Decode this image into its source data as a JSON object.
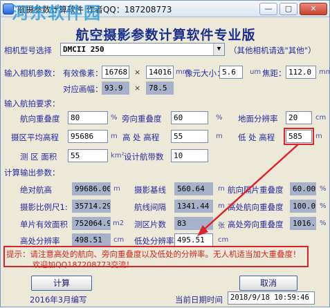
{
  "window": {
    "title": "航摄参数计算软件  作者QQ：187208773",
    "watermark": "河东软件园",
    "watermark_url": "www.pc0359.cn",
    "minimize": "—",
    "maximize": "▢",
    "close": "✕"
  },
  "heading": "航空摄影参数计算软件专业版",
  "camera": {
    "label": "相机型号选择",
    "value": "DMCII 250",
    "hint": "（其他相机请选\"其他\"）"
  },
  "camera_params": {
    "label": "输入相机参数：",
    "pixels_label": "有效像素：",
    "pixels_w": "16768",
    "pixels_h": "14016",
    "pixels_unit": "mm",
    "times": "×",
    "pixel_size_label": "像元大小：",
    "pixel_size": "5.6",
    "pixel_size_unit": "um",
    "focal_label": "焦距：",
    "focal": "112.0",
    "focal_unit": "mm",
    "frame_label": "对应画幅：",
    "frame_w": "93.9",
    "frame_h": "78.5"
  },
  "flight_req": {
    "label": "输入航拍要求：",
    "forward_overlap_label": "航向重叠度",
    "forward_overlap": "80",
    "side_overlap_label": "旁向重叠度",
    "side_overlap": "60",
    "percent": "%",
    "gsd_label": "地面分辨率",
    "gsd": "20",
    "gsd_unit": "cm",
    "avg_elev_label": "摄区平均高程",
    "avg_elev": "95686",
    "m": "m",
    "high_elev_label": "高 处 高程",
    "high_elev": "55",
    "low_elev_label": "低 处 高程",
    "low_elev": "585",
    "area_label": "测 区 面积",
    "area": "55",
    "area_unit": "km²",
    "strips_label": "设计航带数",
    "strips": "10"
  },
  "output": {
    "label": "计算输出参数：",
    "abs_height_label": "绝对航高",
    "abs_height": "99686.00",
    "baseline_label": "摄影基线",
    "baseline": "560.64",
    "photo_overlap_label": "航向隔片重叠度",
    "photo_overlap": "60.00",
    "scale_label": "摄影比例尺1:",
    "scale": "35714.29",
    "line_spacing_label": "航线间隔",
    "line_spacing": "1341.44",
    "high_fwd_overlap_label": "高处航向重叠度",
    "high_fwd_overlap": "100.00",
    "single_area_label": "单片有效面积",
    "single_area": "752064.92",
    "single_area_unit": "m2",
    "photo_count_label": "测区片数",
    "photo_count": "83",
    "photo_count_unit": "张",
    "high_side_overlap_label": "高处旁向重叠度",
    "high_side_overlap": "1016.3",
    "high_gsd_label": "高处分辨率",
    "high_gsd": "498.51",
    "low_gsd_label": "低处分辨率",
    "low_gsd": "495.51",
    "cm": "cm"
  },
  "hint": {
    "text": "提示：请注意高处的航向、旁向重叠度以及低处的分辨率。无人机适当加大重叠度！",
    "sub": "欢迎加QQ187208773交流！"
  },
  "buttons": {
    "calculate": "计算",
    "cancel": "取消"
  },
  "footer": {
    "compiled": "2016年3月编写",
    "date_label": "当前日期时间",
    "datetime": "2018/9/18  10:59:46"
  },
  "colors": {
    "label_blue": "#2a2aa0",
    "readonly_field": "#a7b2ca",
    "highlight_red": "#e0202a"
  }
}
